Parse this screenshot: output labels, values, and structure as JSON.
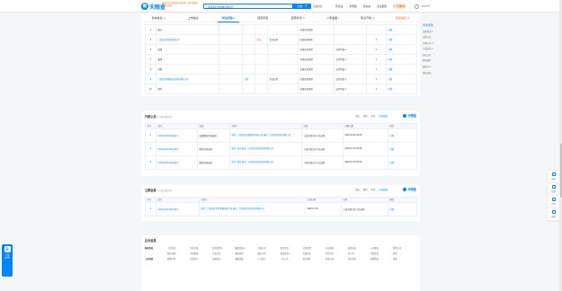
{
  "header": {
    "logo_text": "天眼查",
    "logo_mark": "眼",
    "tagline": "国家中小企业发展子基金旗下 官方备案企业征信机构",
    "search_value": "上海某某信息科技有限公司",
    "search_button": "天眼一下",
    "search_extra": "高级搜索",
    "nav": [
      "查企业",
      "查老板",
      "查关系",
      "企业服务",
      "商务合作"
    ],
    "vip_label": "开通VIP",
    "user_label": "177****"
  },
  "tabs": [
    {
      "label": "基本信息",
      "count": "22"
    },
    {
      "label": "上市信息",
      "count": ""
    },
    {
      "label": "司法风险",
      "count": "8",
      "active": true
    },
    {
      "label": "经营风险",
      "count": ""
    },
    {
      "label": "经营状况",
      "count": "37"
    },
    {
      "label": "公司发展",
      "count": "5"
    },
    {
      "label": "知识产权",
      "count": "32"
    },
    {
      "label": "历史信息",
      "count": "46"
    }
  ],
  "right_rail": {
    "title": "司法风险",
    "items": [
      "法律诉讼 1",
      "法院公告",
      "开庭公告 3",
      "立案信息 1",
      "送达公告",
      "终本案件",
      "被执行人",
      "失信信息"
    ]
  },
  "top_table": {
    "rows": [
      {
        "no": "4",
        "name": "股东",
        "col2": "-",
        "col3": "-",
        "col4": "",
        "col5": "-",
        "col6": "全部业务类型",
        "col7": "-",
        "col8": "-",
        "col9": "详情"
      },
      {
        "no": "5",
        "name": "上海某某科技有限公司",
        "col2": "-",
        "col3": "-",
        "col4": "在业",
        "col5": "企业信用",
        "col6": "信息技术服务",
        "col7": "-",
        "col8": "1",
        "col9": "详情"
      },
      {
        "no": "6",
        "name": "监事",
        "col2": "-",
        "col3": "-",
        "col4": "",
        "col5": "-",
        "col6": "全部业务类型",
        "col7": "法定代表人",
        "col8": "1",
        "col9": "详情"
      },
      {
        "no": "7",
        "name": "董事",
        "col2": "-",
        "col3": "-",
        "col4": "",
        "col5": "-",
        "col6": "全部业务类型",
        "col7": "法定代表人",
        "col8": "1",
        "col9": "详情"
      },
      {
        "no": "8",
        "name": "高管",
        "col2": "-",
        "col3": "-",
        "col4": "",
        "col5": "-",
        "col6": "全部业务类型",
        "col7": "法定代表人",
        "col8": "1",
        "col9": "详情"
      },
      {
        "no": "9",
        "name": "上海某某网络信息技术有限公司",
        "col2": "-",
        "col3": "存续",
        "col4": "",
        "col5": "企业信用",
        "col6": "全部业务类型",
        "col7": "法定代表人",
        "col8": "1",
        "col9": "详情"
      },
      {
        "no": "10",
        "name": "财务",
        "col2": "-",
        "col3": "-",
        "col4": "",
        "col5": "-",
        "col6": "全部业务类型",
        "col7": "法定代表人",
        "col8": "1",
        "col9": "详情"
      }
    ]
  },
  "hearing_card": {
    "title": "开庭公告",
    "count_sub": "3  开庭日期排序",
    "tools": [
      "案由",
      "角色",
      "年份",
      "导出数据"
    ],
    "watermark": "天眼查",
    "headers": [
      "序号",
      "案号",
      "案由",
      "当事人",
      "法院",
      "开庭日期",
      "操作"
    ],
    "rows": [
      {
        "no": "1",
        "case_no": "(2024)沪0104民初4号",
        "cause": "金融借款合同纠纷",
        "party": "原告: 上海某某金融服务有限公司 被告: 上海某某科技有限公司",
        "court": "上海市徐汇区人民法院",
        "date": "2024-03-20 09:00",
        "action": "详情"
      },
      {
        "no": "2",
        "case_no": "(2023)沪0104民初8号",
        "cause": "借款合同纠纷",
        "party": "原告: 某某 被告: 上海某某信息技术有限公司",
        "court": "上海市徐汇区人民法院",
        "date": "2023-07-20 09:30",
        "action": "详情"
      },
      {
        "no": "3",
        "case_no": "(2023)沪0104民初5号",
        "cause": "借款合同纠纷",
        "party": "原告: 某某 被告: 上海某某信息技术有限公司",
        "court": "上海市徐汇区人民法院",
        "date": "2023-07-19 09:00",
        "action": "详情"
      }
    ]
  },
  "filing_card": {
    "title": "立案信息",
    "count_sub": "1  立案日期排序",
    "tools": [
      "案由",
      "角色",
      "年份",
      "导出数据"
    ],
    "watermark": "天眼查",
    "headers": [
      "序号",
      "案号",
      "当事人",
      "立案日期",
      "法院",
      "操作"
    ],
    "rows": [
      {
        "no": "1",
        "case_no": "(2024)沪0104民初3号",
        "party": "原告: 上海某某文化传播有限公司 被告: 上海某某信息技术有限公司",
        "date": "2024-07-01",
        "court": "上海市徐汇区人民法院",
        "action": "详情"
      }
    ]
  },
  "info_card": {
    "title": "企业信息",
    "rows": [
      [
        "基本信息",
        "工商信息",
        "企业年报",
        "实际控制人",
        "最终受益人",
        "主要人员",
        "股东信息",
        "对外投资",
        "分支机构",
        "变更记录",
        "公司概况",
        "联系方式"
      ],
      [
        "",
        "股权穿透",
        "企业图谱",
        "历史沿革",
        "股权结构",
        "疑似关系",
        "受益所有人",
        "关联企业",
        "企业关系",
        "总公司",
        "控股企业",
        "更多"
      ],
      [
        "上市信息",
        "股票行情",
        "企业简介",
        "高管信息",
        "参股控股",
        "十大股东",
        "上市公告",
        "发行相关",
        "证券信息",
        "分红情况",
        "配股情况",
        "更多"
      ]
    ]
  },
  "app_badge": {
    "icon": "天",
    "line1": "下载",
    "line2": "APP"
  },
  "float_panel": [
    "咨询",
    "反馈",
    "分享",
    "顶部"
  ]
}
